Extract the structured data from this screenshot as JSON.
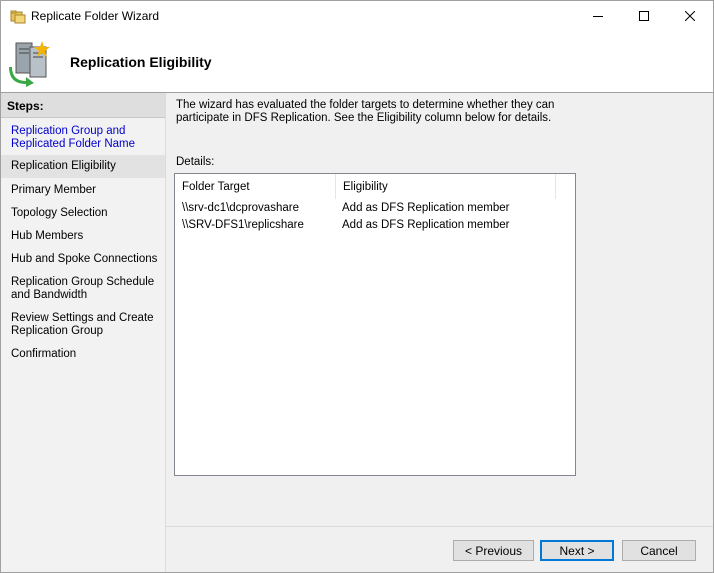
{
  "window": {
    "title": "Replicate Folder Wizard"
  },
  "header": {
    "title": "Replication Eligibility"
  },
  "steps": {
    "heading": "Steps:",
    "items": [
      {
        "label": "Replication Group and Replicated Folder Name",
        "state": "link"
      },
      {
        "label": "Replication Eligibility",
        "state": "current"
      },
      {
        "label": "Primary Member",
        "state": "normal"
      },
      {
        "label": "Topology Selection",
        "state": "normal"
      },
      {
        "label": "Hub Members",
        "state": "normal"
      },
      {
        "label": "Hub and Spoke Connections",
        "state": "normal"
      },
      {
        "label": "Replication Group Schedule and Bandwidth",
        "state": "normal"
      },
      {
        "label": "Review Settings and Create Replication Group",
        "state": "normal"
      },
      {
        "label": "Confirmation",
        "state": "normal"
      }
    ]
  },
  "main": {
    "description": "The wizard has evaluated the folder targets to determine whether they can participate in DFS Replication. See the Eligibility column below for details.",
    "details_label": "Details:",
    "table": {
      "columns": [
        "Folder Target",
        "Eligibility"
      ],
      "rows": [
        [
          "\\\\srv-dc1\\dcprovashare",
          "Add as DFS Replication member"
        ],
        [
          "\\\\SRV-DFS1\\replicshare",
          "Add as DFS Replication member"
        ]
      ]
    }
  },
  "buttons": {
    "previous": "< Previous",
    "next": "Next >",
    "cancel": "Cancel"
  },
  "colors": {
    "link": "#0000cc",
    "accent": "#0078d7"
  }
}
